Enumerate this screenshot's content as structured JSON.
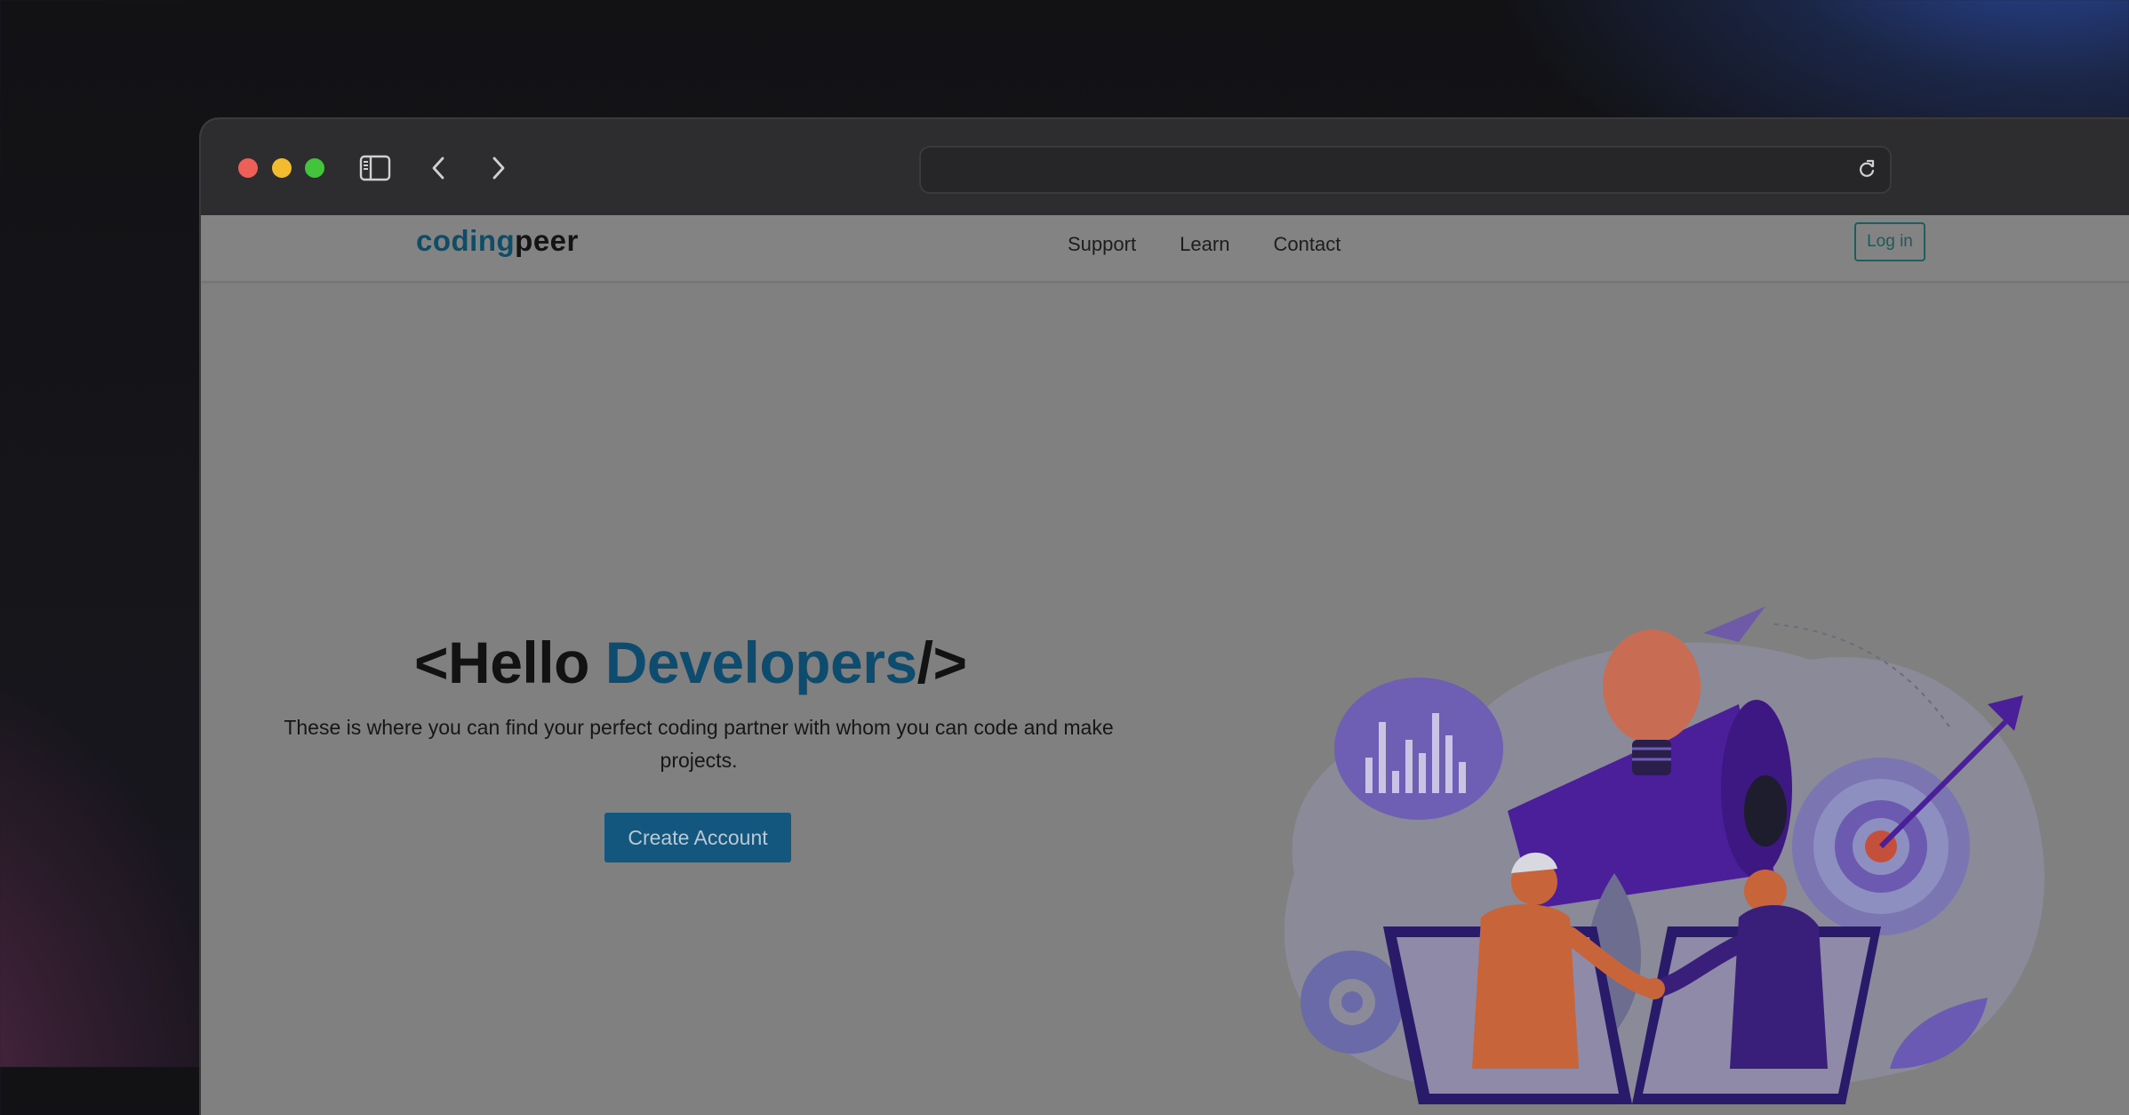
{
  "browser": {
    "url": "",
    "icons": {
      "sidebar": "sidebar-icon",
      "back": "chevron-left-icon",
      "forward": "chevron-right-icon",
      "reload": "reload-icon"
    }
  },
  "nav": {
    "logo_part1": "coding",
    "logo_part2": "peer",
    "links": [
      "Support",
      "Learn",
      "Contact"
    ],
    "login_label": "Log in"
  },
  "hero": {
    "title_prefix": "<Hello ",
    "title_highlight": "Developers",
    "title_suffix": "/>",
    "description": "These is where you can find your perfect coding partner with whom you can code and make projects.",
    "cta_label": "Create Account"
  },
  "colors": {
    "logo_accent": "#0f4c66",
    "title_accent": "#0d4c6e",
    "cta_background": "#14577e",
    "illustration_purple": "#5b2ab0",
    "illustration_orange": "#c8643a"
  }
}
